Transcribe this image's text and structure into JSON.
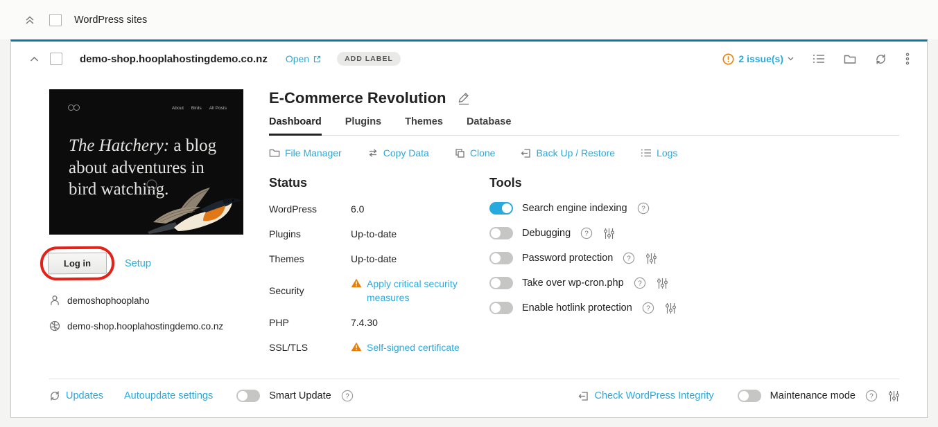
{
  "colors": {
    "accent_blue": "#28aade",
    "card_top_border": "#0b76a8",
    "warning_orange": "#e87e04",
    "annotation_red": "#e2231a"
  },
  "group_header": {
    "title": "WordPress sites"
  },
  "card": {
    "header": {
      "domain": "demo-shop.hooplahostingdemo.co.nz",
      "open_label": "Open",
      "add_label": "ADD LABEL",
      "issues_label": "2 issue(s)"
    },
    "preview": {
      "nav": [
        {
          "label": "About"
        },
        {
          "label": "Birds"
        },
        {
          "label": "All Posts"
        }
      ],
      "headline_em": "The Hatchery:",
      "headline_rest": " a blog about adventures in bird watching."
    },
    "left": {
      "login_button": "Log in",
      "setup_link": "Setup",
      "username": "demoshophooplaho",
      "site_url": "demo-shop.hooplahostingdemo.co.nz"
    },
    "main": {
      "title": "E-Commerce Revolution",
      "tabs": [
        {
          "label": "Dashboard",
          "active": true
        },
        {
          "label": "Plugins",
          "active": false
        },
        {
          "label": "Themes",
          "active": false
        },
        {
          "label": "Database",
          "active": false
        }
      ],
      "actions": [
        {
          "label": "File Manager",
          "icon": "folder-icon"
        },
        {
          "label": "Copy Data",
          "icon": "copy-data-icon"
        },
        {
          "label": "Clone",
          "icon": "clone-icon"
        },
        {
          "label": "Back Up / Restore",
          "icon": "backup-icon"
        },
        {
          "label": "Logs",
          "icon": "logs-icon"
        }
      ],
      "status": {
        "heading": "Status",
        "rows": [
          {
            "label": "WordPress",
            "value": "6.0",
            "warning": false
          },
          {
            "label": "Plugins",
            "value": "Up-to-date",
            "warning": false
          },
          {
            "label": "Themes",
            "value": "Up-to-date",
            "warning": false
          },
          {
            "label": "Security",
            "value": "Apply critical security measures",
            "warning": true
          },
          {
            "label": "PHP",
            "value": "7.4.30",
            "warning": false
          },
          {
            "label": "SSL/TLS",
            "value": "Self-signed certificate",
            "warning": true
          }
        ]
      },
      "tools": {
        "heading": "Tools",
        "rows": [
          {
            "label": "Search engine indexing",
            "on": true,
            "help": true,
            "settings": false
          },
          {
            "label": "Debugging",
            "on": false,
            "help": true,
            "settings": true
          },
          {
            "label": "Password protection",
            "on": false,
            "help": true,
            "settings": true
          },
          {
            "label": "Take over wp-cron.php",
            "on": false,
            "help": true,
            "settings": true
          },
          {
            "label": "Enable hotlink protection",
            "on": false,
            "help": true,
            "settings": true
          }
        ]
      }
    },
    "footer": {
      "updates_label": "Updates",
      "autoupdate_label": "Autoupdate settings",
      "smart_update_label": "Smart Update",
      "check_integrity_label": "Check WordPress Integrity",
      "maintenance_label": "Maintenance mode"
    }
  }
}
